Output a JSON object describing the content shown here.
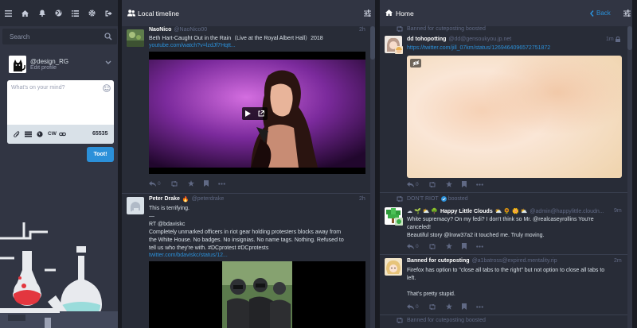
{
  "toolbar": {
    "icons": [
      "menu-icon",
      "home-icon",
      "bell-icon",
      "globe-icon",
      "list-icon",
      "gear-icon",
      "logout-icon"
    ]
  },
  "search": {
    "placeholder": "Search"
  },
  "profile": {
    "handle": "@design_RG",
    "edit_label": "Edit profile"
  },
  "compose": {
    "placeholder": "What's on your mind?",
    "cw_label": "CW",
    "char_count": "65535",
    "toot_label": "Toot!"
  },
  "local": {
    "title": "Local timeline",
    "posts": [
      {
        "display_name": "NaoNico",
        "acct": "@NaoNico00",
        "time": "2h",
        "text": "Beth Hart-Caught Out in the Rain（Live at the Royal Albert Hall）2018",
        "link": "youtube.com/watch?v=lzdJf7Hqtt..."
      },
      {
        "display_name": "Peter Drake",
        "emoji": "🔥",
        "acct": "@peterdrake",
        "time": "2h",
        "lines": [
          "This is terrifying.",
          "—",
          "RT @bdaviskc",
          "Completely unmarked officers in riot gear holding protesters blocks away from",
          "the White House. No badges. No insignias. No name tags. Nothing. Refused to",
          "tell us who they're with. #DCprotest #DCprotests"
        ],
        "link": "twitter.com/bdaviskc/status/12..."
      }
    ]
  },
  "home": {
    "title": "Home",
    "back_label": "Back",
    "posts": [
      {
        "boosted_by": "Banned for cuteposting boosted",
        "display_name": "dd tohopotting",
        "acct": "@dd@gensoukyou.jp.net",
        "time": "1m",
        "link": "https://twitter.com/jill_07km/status/1269464096572751872"
      },
      {
        "boosted_by": "DON'T RIOT",
        "boosted_suffix": "boosted",
        "display_name": "Happy Little Clouds",
        "acct": "@admin@happylittle.cloudn...",
        "time": "9m",
        "lines": [
          "White supremacy? On my fedi? I don't think so Mr. @realcaseyrollins You're",
          "canceled!",
          "Beautiful story @lnxw37a2 it touched me. Truly moving."
        ]
      },
      {
        "display_name": "Banned for cuteposting",
        "acct": "@a1batross@expired.mentality.rip",
        "time": "2m",
        "lines": [
          "Firefox has option to \"close all tabs to the right\" but not option to close all tabs to",
          "left.",
          "",
          "That's pretty stupid."
        ]
      },
      {
        "boosted_by": "Banned for cuteposting boosted"
      }
    ]
  },
  "colors": {
    "background": "#191b22",
    "column": "#282c37",
    "header": "#313543",
    "accent": "#2b90d9",
    "muted": "#606984"
  }
}
